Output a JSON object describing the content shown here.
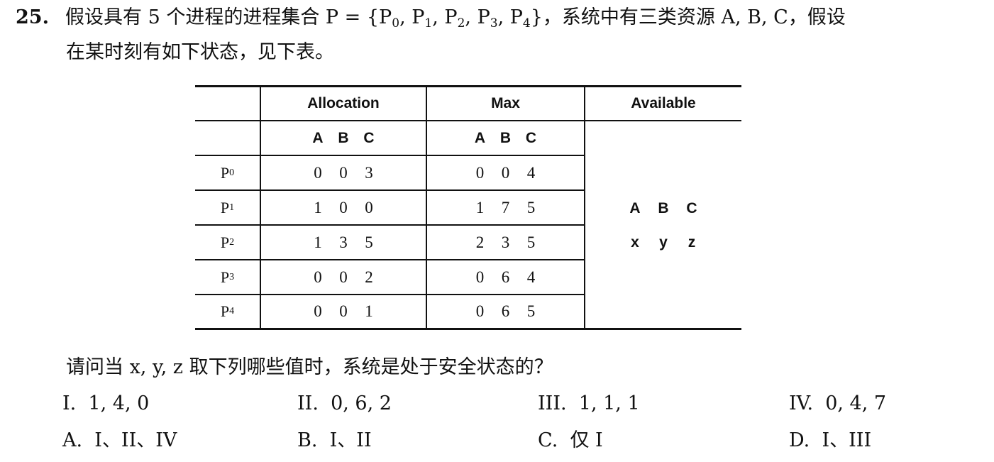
{
  "question": {
    "number": "25.",
    "intro": "假设具有 5 个进程的进程集合 P = {P",
    "set_subs": [
      "0",
      "1",
      "2",
      "3",
      "4"
    ],
    "intro_tail": "}，系统中有三类资源 A, B, C，假设",
    "line2": "在某时刻有如下状态，见下表。",
    "ask": "请问当 x, y, z 取下列哪些值时，系统是处于安全状态的？"
  },
  "table": {
    "headers": {
      "allocation": "Allocation",
      "max": "Max",
      "available": "Available"
    },
    "resource_letters": [
      "A",
      "B",
      "C"
    ],
    "rows": [
      {
        "process": "P",
        "sub": "0",
        "allocation": [
          "0",
          "0",
          "3"
        ],
        "max": [
          "0",
          "0",
          "4"
        ]
      },
      {
        "process": "P",
        "sub": "1",
        "allocation": [
          "1",
          "0",
          "0"
        ],
        "max": [
          "1",
          "7",
          "5"
        ]
      },
      {
        "process": "P",
        "sub": "2",
        "allocation": [
          "1",
          "3",
          "5"
        ],
        "max": [
          "2",
          "3",
          "5"
        ]
      },
      {
        "process": "P",
        "sub": "3",
        "allocation": [
          "0",
          "0",
          "2"
        ],
        "max": [
          "0",
          "6",
          "4"
        ]
      },
      {
        "process": "P",
        "sub": "4",
        "allocation": [
          "0",
          "0",
          "1"
        ],
        "max": [
          "0",
          "6",
          "5"
        ]
      }
    ],
    "available_letters": [
      "A",
      "B",
      "C"
    ],
    "available_values": [
      "x",
      "y",
      "z"
    ]
  },
  "choices": [
    {
      "label": "I.",
      "value": "1, 4, 0"
    },
    {
      "label": "II.",
      "value": "0, 6, 2"
    },
    {
      "label": "III.",
      "value": "1, 1, 1"
    },
    {
      "label": "IV.",
      "value": "0, 4, 7"
    }
  ],
  "answers": [
    {
      "label": "A.",
      "value": "I、II、IV"
    },
    {
      "label": "B.",
      "value": "I、II"
    },
    {
      "label": "C.",
      "value": "仅 I"
    },
    {
      "label": "D.",
      "value": "I、III"
    }
  ]
}
